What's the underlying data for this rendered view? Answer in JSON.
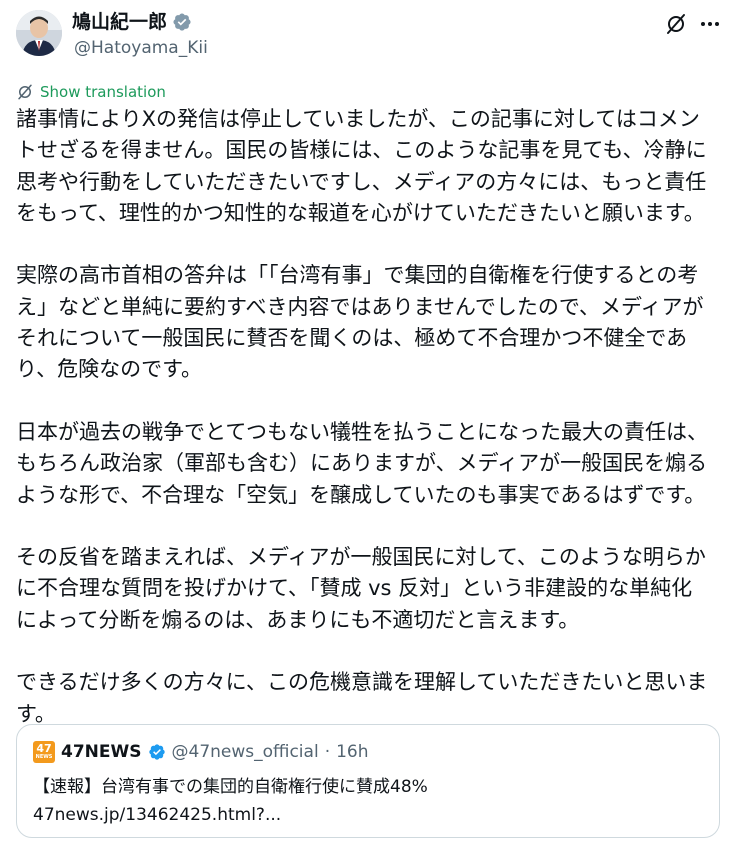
{
  "author": {
    "display_name": "鳩山紀一郎",
    "handle": "@Hatoyama_Kii"
  },
  "actions": {
    "translate_label": "Show translation"
  },
  "post": {
    "paragraphs": [
      [
        "諸事情によりXの発信は停止していましたが、この記事に対してはコメン",
        "トせざるを得ません。国民の皆様には、このような記事を見ても、冷静に",
        "思考や行動をしていただきたいですし、メディアの方々には、もっと責任",
        "をもって、理性的かつ知性的な報道を心がけていただきたいと願います。"
      ],
      [
        "実際の高市首相の答弁は「「台湾有事」で集団的自衛権を行使するとの考",
        "え」などと単純に要約すべき内容ではありませんでしたので、メディアが",
        "それについて一般国民に賛否を聞くのは、極めて不合理かつ不健全であ",
        "り、危険なのです。"
      ],
      [
        "日本が過去の戦争でとてつもない犠牲を払うことになった最大の責任は、",
        "もちろん政治家（軍部も含む）にありますが、メディアが一般国民を煽る",
        "ような形で、不合理な「空気」を醸成していたのも事実であるはずです。"
      ],
      [
        "その反省を踏まえれば、メディアが一般国民に対して、このような明らか",
        "に不合理な質問を投げかけて、「賛成 vs 反対」という非建設的な単純化",
        "によって分断を煽るのは、あまりにも不適切だと言えます。"
      ],
      [
        "できるだけ多くの方々に、この危機意識を理解していただきたいと思いま",
        "す。"
      ]
    ]
  },
  "quote": {
    "logo_text": "47",
    "logo_sub": "NEWS",
    "name": "47NEWS",
    "handle": "@47news_official",
    "separator": "·",
    "time": "16h",
    "text": "【速報】台湾有事での集団的自衛権行使に賛成48%",
    "link": "47news.jp/13462425.html?..."
  },
  "colors": {
    "verified": "#1d9bf0",
    "translate": "#1d9a5b",
    "secondary": "#536471"
  },
  "icons": [
    "verified-badge-icon",
    "grok-icon",
    "more-icon",
    "translate-icon"
  ]
}
